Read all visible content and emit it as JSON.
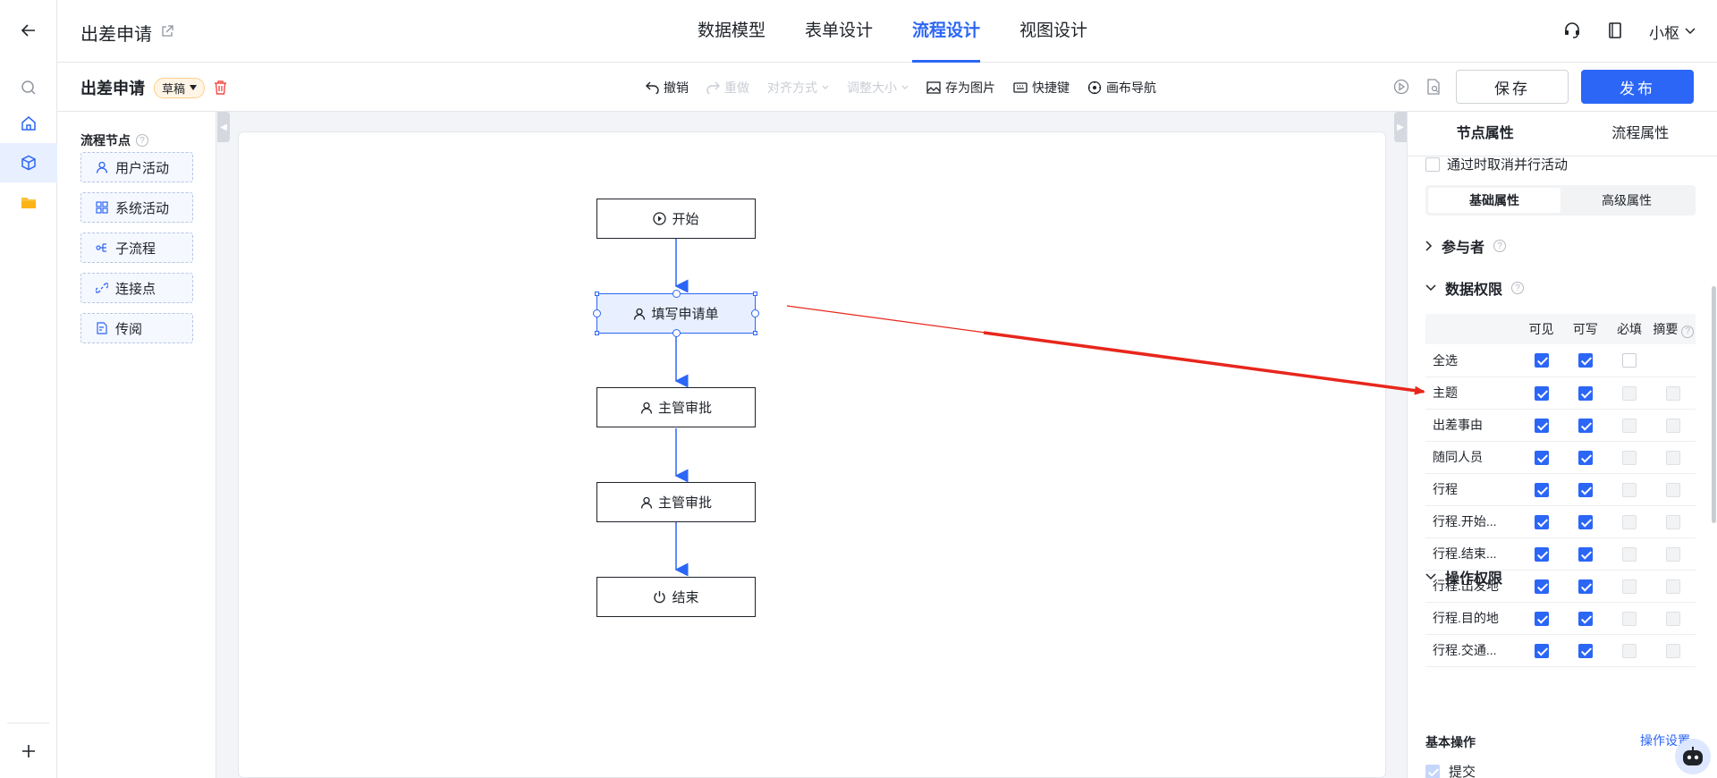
{
  "app": {
    "title": "出差申请",
    "main_tabs": [
      {
        "label": "数据模型",
        "active": false
      },
      {
        "label": "表单设计",
        "active": false
      },
      {
        "label": "流程设计",
        "active": true
      },
      {
        "label": "视图设计",
        "active": false
      }
    ],
    "user_name": "小枢"
  },
  "toolbar": {
    "doc_title": "出差申请",
    "status": "草稿",
    "tools": {
      "undo": "撤销",
      "redo": "重做",
      "align": "对齐方式",
      "resize": "调整大小",
      "save_image": "存为图片",
      "shortcuts": "快捷键",
      "canvas_nav": "画布导航"
    },
    "save_label": "保存",
    "publish_label": "发布"
  },
  "palette": {
    "title": "流程节点",
    "items": [
      {
        "label": "用户活动",
        "icon": "user-icon"
      },
      {
        "label": "系统活动",
        "icon": "grid-icon"
      },
      {
        "label": "子流程",
        "icon": "branch-icon"
      },
      {
        "label": "连接点",
        "icon": "link-icon"
      },
      {
        "label": "传阅",
        "icon": "circulate-icon"
      }
    ]
  },
  "flow": {
    "nodes": [
      {
        "label": "开始",
        "icon": "play-icon"
      },
      {
        "label": "填写申请单",
        "icon": "user-icon",
        "selected": true
      },
      {
        "label": "主管审批",
        "icon": "user-icon"
      },
      {
        "label": "主管审批",
        "icon": "user-icon"
      },
      {
        "label": "结束",
        "icon": "power-icon"
      }
    ]
  },
  "panel": {
    "tabs": [
      {
        "label": "节点属性",
        "active": true
      },
      {
        "label": "流程属性",
        "active": false
      }
    ],
    "cut_off_option": "通过时取消并行活动",
    "sub_tabs": [
      {
        "label": "基础属性",
        "active": true
      },
      {
        "label": "高级属性",
        "active": false
      }
    ],
    "participants_label": "参与者",
    "data_perm_label": "数据权限",
    "columns": [
      "可见",
      "可写",
      "必填",
      "摘要"
    ],
    "rows": [
      {
        "name": "全选",
        "visible": true,
        "writable": true,
        "required": false,
        "summary": null
      },
      {
        "name": "主题",
        "visible": true,
        "writable": true,
        "required": false,
        "summary": false
      },
      {
        "name": "出差事由",
        "visible": true,
        "writable": true,
        "required": false,
        "summary": false
      },
      {
        "name": "随同人员",
        "visible": true,
        "writable": true,
        "required": false,
        "summary": false
      },
      {
        "name": "行程",
        "visible": true,
        "writable": true,
        "required": false,
        "summary": false
      },
      {
        "name": "行程.开始...",
        "visible": true,
        "writable": true,
        "required": false,
        "summary": false
      },
      {
        "name": "行程.结束...",
        "visible": true,
        "writable": true,
        "required": false,
        "summary": false
      },
      {
        "name": "行程.出发地",
        "visible": true,
        "writable": true,
        "required": false,
        "summary": false
      },
      {
        "name": "行程.目的地",
        "visible": true,
        "writable": true,
        "required": false,
        "summary": false
      },
      {
        "name": "行程.交通...",
        "visible": true,
        "writable": true,
        "required": false,
        "summary": false
      }
    ],
    "op_perm_label": "操作权限",
    "basic_op_label": "基本操作",
    "op_settings_link": "操作设置",
    "submit_label": "提交"
  },
  "colors": {
    "accent": "#2b66f6",
    "annotation_arrow": "#e8261c"
  }
}
